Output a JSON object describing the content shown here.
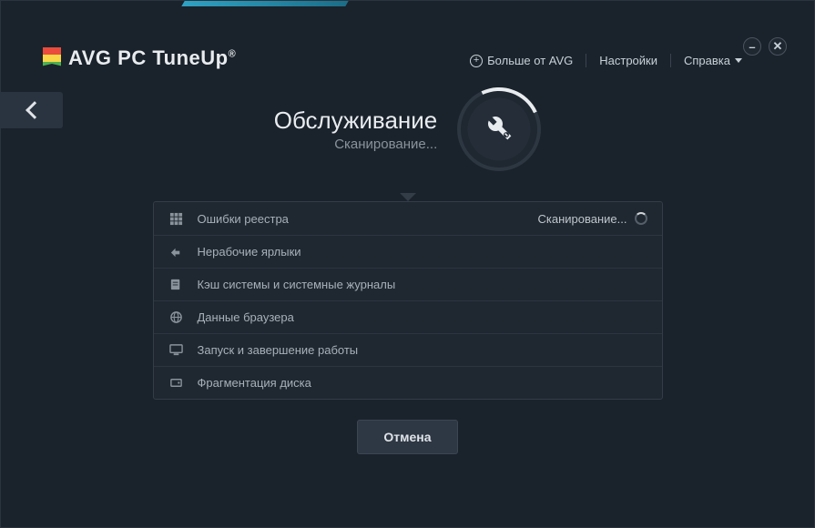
{
  "brand": {
    "avg": "AVG",
    "product": "PC TuneUp",
    "reg": "®"
  },
  "topnav": {
    "more": "Больше от AVG",
    "settings": "Настройки",
    "help": "Справка"
  },
  "title": {
    "heading": "Обслуживание",
    "sub": "Сканирование..."
  },
  "rows": [
    {
      "icon": "grid-icon",
      "label": "Ошибки реестра",
      "status": "Сканирование..."
    },
    {
      "icon": "shortcut-icon",
      "label": "Нерабочие ярлыки",
      "status": ""
    },
    {
      "icon": "log-icon",
      "label": "Кэш системы и системные журналы",
      "status": ""
    },
    {
      "icon": "globe-icon",
      "label": "Данные браузера",
      "status": ""
    },
    {
      "icon": "monitor-icon",
      "label": "Запуск и завершение работы",
      "status": ""
    },
    {
      "icon": "disk-icon",
      "label": "Фрагментация диска",
      "status": ""
    }
  ],
  "cancel": "Отмена"
}
